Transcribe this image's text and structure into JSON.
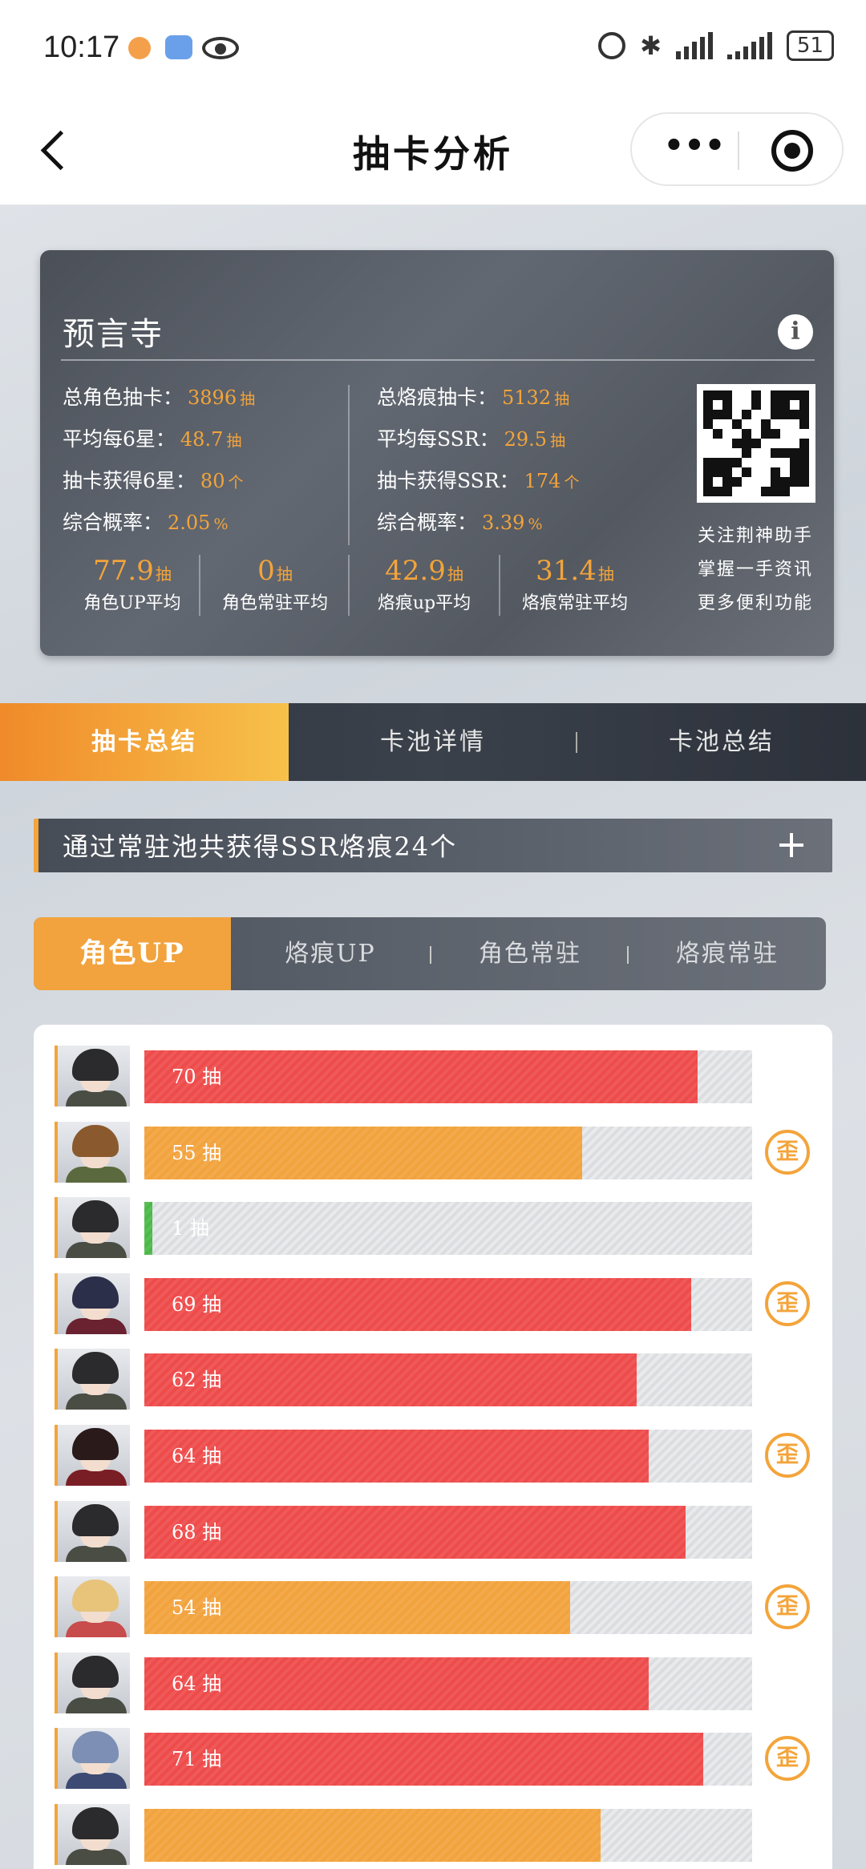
{
  "status_bar": {
    "time": "10:17",
    "battery": "51"
  },
  "header": {
    "title": "抽卡分析"
  },
  "summary": {
    "title": "预言寺",
    "left_stats": [
      {
        "label": "总角色抽卡：",
        "value": "3896",
        "unit": "抽"
      },
      {
        "label": "平均每6星：",
        "value": "48.7",
        "unit": "抽"
      },
      {
        "label": "抽卡获得6星：",
        "value": "80",
        "unit": "个"
      },
      {
        "label": "综合概率：",
        "value": "2.05",
        "unit": "%"
      }
    ],
    "right_stats": [
      {
        "label": "总烙痕抽卡：",
        "value": "5132",
        "unit": "抽"
      },
      {
        "label": "平均每SSR：",
        "value": "29.5",
        "unit": "抽"
      },
      {
        "label": "抽卡获得SSR：",
        "value": "174",
        "unit": "个"
      },
      {
        "label": "综合概率：",
        "value": "3.39",
        "unit": "%"
      }
    ],
    "averages": [
      {
        "value": "77.9",
        "unit": "抽",
        "label": "角色UP平均"
      },
      {
        "value": "0",
        "unit": "抽",
        "label": "角色常驻平均"
      },
      {
        "value": "42.9",
        "unit": "抽",
        "label": "烙痕up平均"
      },
      {
        "value": "31.4",
        "unit": "抽",
        "label": "烙痕常驻平均"
      }
    ],
    "qr_caption": [
      "关注荆神助手",
      "掌握一手资讯",
      "更多便利功能"
    ]
  },
  "main_tabs": [
    "抽卡总结",
    "卡池详情",
    "卡池总结"
  ],
  "banner": {
    "text": "通过常驻池共获得SSR烙痕24个"
  },
  "sub_tabs": [
    "角色UP",
    "烙痕UP",
    "角色常驻",
    "烙痕常驻"
  ],
  "badge_text": "歪",
  "pulls": [
    {
      "label": "70 抽",
      "fraction": 0.91,
      "color": "#ee4b4b",
      "badge": false,
      "avatar": "male-dark"
    },
    {
      "label": "55 抽",
      "fraction": 0.72,
      "color": "#f2a33d",
      "badge": true,
      "avatar": "female-brown"
    },
    {
      "label": "1 抽",
      "fraction": 0.013,
      "color": "#4cb848",
      "badge": false,
      "avatar": "male-dark"
    },
    {
      "label": "69 抽",
      "fraction": 0.9,
      "color": "#ee4b4b",
      "badge": true,
      "avatar": "male-blue"
    },
    {
      "label": "62 抽",
      "fraction": 0.81,
      "color": "#ee4b4b",
      "badge": false,
      "avatar": "male-dark"
    },
    {
      "label": "64 抽",
      "fraction": 0.83,
      "color": "#ee4b4b",
      "badge": true,
      "avatar": "pirate"
    },
    {
      "label": "68 抽",
      "fraction": 0.89,
      "color": "#ee4b4b",
      "badge": false,
      "avatar": "male-dark"
    },
    {
      "label": "54 抽",
      "fraction": 0.7,
      "color": "#f2a33d",
      "badge": true,
      "avatar": "female-blonde"
    },
    {
      "label": "64 抽",
      "fraction": 0.83,
      "color": "#ee4b4b",
      "badge": false,
      "avatar": "male-dark"
    },
    {
      "label": "71 抽",
      "fraction": 0.92,
      "color": "#ee4b4b",
      "badge": true,
      "avatar": "female-silver"
    },
    {
      "label": "",
      "fraction": 0.75,
      "color": "#f2a33d",
      "badge": false,
      "avatar": "male-dark"
    }
  ]
}
